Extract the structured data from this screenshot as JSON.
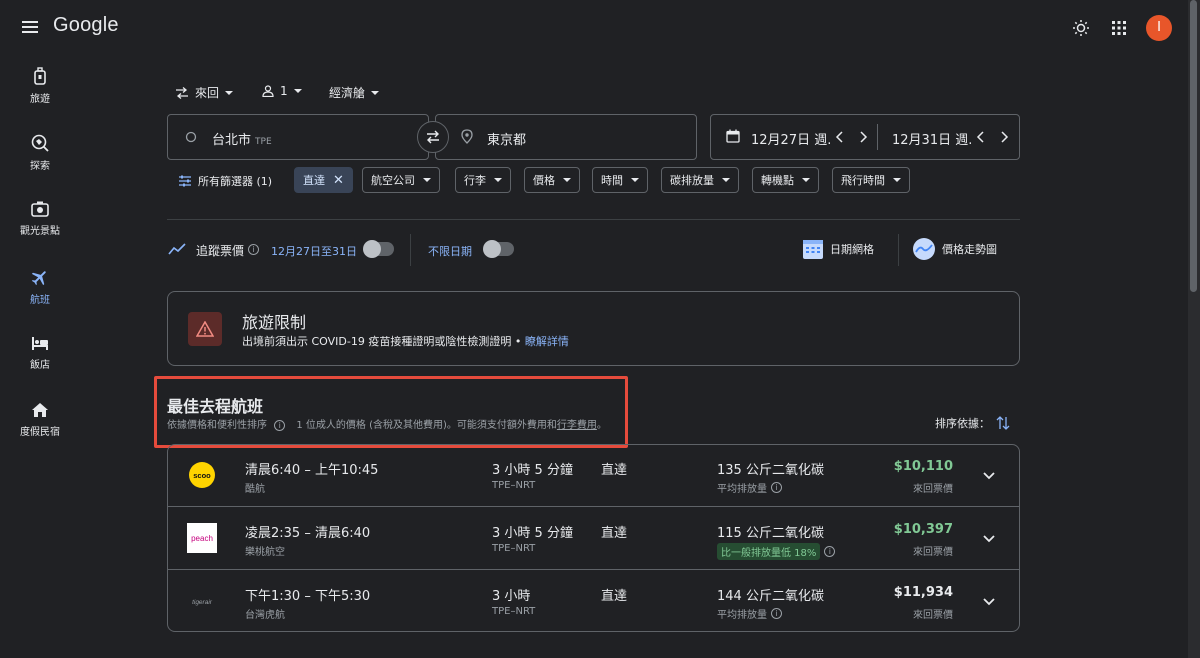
{
  "app": {
    "logo": "Google",
    "avatar_letter": "I"
  },
  "sidebar": {
    "items": [
      {
        "label": "旅遊",
        "icon": "luggage-icon"
      },
      {
        "label": "探索",
        "icon": "explore-icon"
      },
      {
        "label": "觀光景點",
        "icon": "camera-icon"
      },
      {
        "label": "航班",
        "icon": "flight-icon",
        "active": true
      },
      {
        "label": "飯店",
        "icon": "hotel-icon"
      },
      {
        "label": "度假民宿",
        "icon": "home-icon"
      }
    ]
  },
  "search": {
    "trip_type": "來回",
    "passengers": "1",
    "cabin": "經濟艙",
    "origin": "台北市",
    "origin_code": "TPE",
    "destination": "東京都",
    "depart_date": "12月27日 週.",
    "return_date": "12月31日 週."
  },
  "filters": {
    "all_filters": "所有篩選器 (1)",
    "chips": [
      "直達",
      "航空公司",
      "行李",
      "價格",
      "時間",
      "碳排放量",
      "轉機點",
      "飛行時間"
    ]
  },
  "tracking": {
    "track_label": "追蹤票價",
    "date_range": "12月27日至31日",
    "any_dates": "不限日期",
    "date_grid": "日期網格",
    "price_graph": "價格走勢圖"
  },
  "restriction": {
    "title": "旅遊限制",
    "text": "出境前須出示 COVID-19 疫苗接種證明或陰性檢測證明",
    "link": "瞭解詳情"
  },
  "best": {
    "title": "最佳去程航班",
    "sort_note": "依據價格和便利性排序",
    "price_note": "1 位成人的價格 (含稅及其他費用)。可能須支付額外費用和",
    "baggage_link": "行李費用",
    "sort_by": "排序依據："
  },
  "flights": [
    {
      "logo": "scoot",
      "times": "清晨6:40 – 上午10:45",
      "airline": "酷航",
      "duration": "3 小時 5 分鐘",
      "route": "TPE–NRT",
      "stops": "直達",
      "co2": "135 公斤二氧化碳",
      "co2_note": "平均排放量",
      "price": "$10,110",
      "price_type": "來回票價",
      "price_color": "#81c995"
    },
    {
      "logo": "peach",
      "times": "凌晨2:35 – 清晨6:40",
      "airline": "樂桃航空",
      "duration": "3 小時 5 分鐘",
      "route": "TPE–NRT",
      "stops": "直達",
      "co2": "115 公斤二氧化碳",
      "co2_note": "比一般排放量低 18%",
      "price": "$10,397",
      "price_type": "來回票價",
      "price_color": "#81c995"
    },
    {
      "logo": "tigerair",
      "times": "下午1:30 – 下午5:30",
      "airline": "台灣虎航",
      "duration": "3 小時",
      "route": "TPE–NRT",
      "stops": "直達",
      "co2": "144 公斤二氧化碳",
      "co2_note": "平均排放量",
      "price": "$11,934",
      "price_type": "來回票價",
      "price_color": "#e8eaed"
    }
  ]
}
